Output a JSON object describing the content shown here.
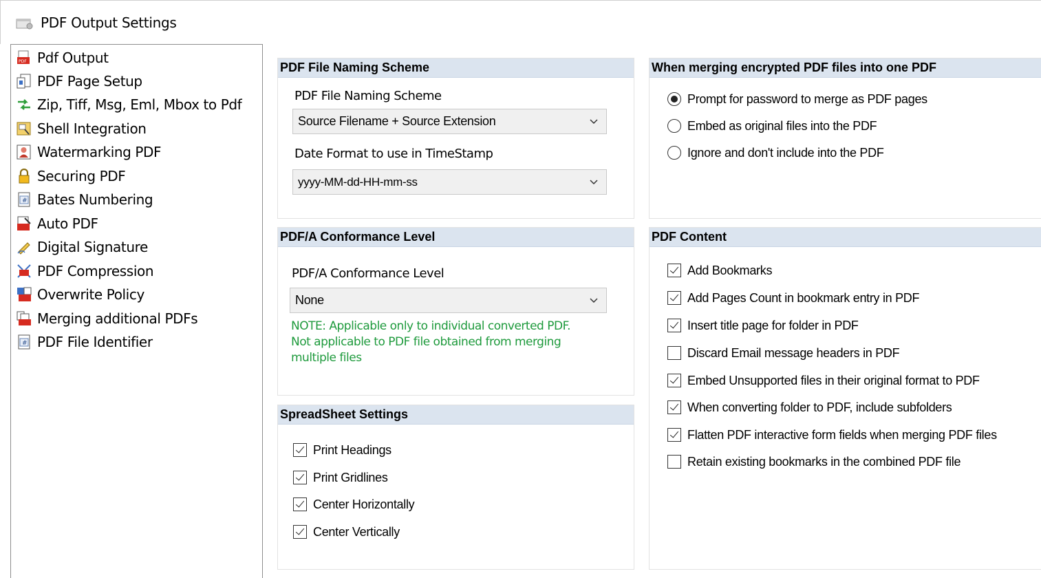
{
  "window": {
    "title": "PDF Output Settings",
    "icon": "settings-window-icon"
  },
  "sidebar": {
    "items": [
      {
        "label": "Pdf Output",
        "icon": "pdf-output-icon"
      },
      {
        "label": "PDF Page Setup",
        "icon": "page-setup-icon"
      },
      {
        "label": "Zip, Tiff, Msg, Eml, Mbox to Pdf",
        "icon": "convert-arrows-icon"
      },
      {
        "label": "Shell Integration",
        "icon": "shell-integration-icon"
      },
      {
        "label": "Watermarking PDF",
        "icon": "watermark-icon"
      },
      {
        "label": "Securing PDF",
        "icon": "lock-icon"
      },
      {
        "label": "Bates Numbering",
        "icon": "hash-icon"
      },
      {
        "label": "Auto PDF",
        "icon": "auto-pdf-icon"
      },
      {
        "label": "Digital Signature",
        "icon": "signature-pen-icon"
      },
      {
        "label": "PDF Compression",
        "icon": "compression-icon"
      },
      {
        "label": "Overwrite Policy",
        "icon": "overwrite-icon"
      },
      {
        "label": "Merging additional PDFs",
        "icon": "merge-pdf-icon"
      },
      {
        "label": "PDF File Identifier",
        "icon": "hash-icon"
      }
    ]
  },
  "naming": {
    "header": "PDF File Naming Scheme",
    "scheme_label": "PDF File Naming Scheme",
    "scheme_value": "Source Filename + Source Extension",
    "date_label": "Date Format to use in TimeStamp",
    "date_value": "yyyy-MM-dd-HH-mm-ss"
  },
  "encrypted": {
    "header": "When merging encrypted PDF files into one PDF",
    "options": [
      {
        "label": "Prompt for password to merge as PDF pages",
        "selected": true
      },
      {
        "label": "Embed as original files into the PDF",
        "selected": false
      },
      {
        "label": "Ignore and don't include into the PDF",
        "selected": false
      }
    ]
  },
  "pdfa": {
    "header": "PDF/A Conformance Level",
    "level_label": "PDF/A Conformance Level",
    "level_value": "None",
    "note_lines": [
      "NOTE: Applicable only to individual converted PDF.",
      "Not applicable to PDF file obtained from merging",
      "multiple files"
    ]
  },
  "spreadsheet": {
    "header": "SpreadSheet Settings",
    "options": [
      {
        "label": "Print Headings",
        "checked": true
      },
      {
        "label": "Print Gridlines",
        "checked": true
      },
      {
        "label": "Center Horizontally",
        "checked": true
      },
      {
        "label": "Center Vertically",
        "checked": true
      }
    ]
  },
  "content": {
    "header": "PDF Content",
    "options": [
      {
        "label": "Add Bookmarks",
        "checked": true
      },
      {
        "label": "Add Pages Count in bookmark entry in PDF",
        "checked": true
      },
      {
        "label": "Insert title page for folder in PDF",
        "checked": true
      },
      {
        "label": "Discard Email message headers in PDF",
        "checked": false
      },
      {
        "label": "Embed Unsupported files in their original format to PDF",
        "checked": true
      },
      {
        "label": "When converting folder to PDF, include subfolders",
        "checked": true
      },
      {
        "label": "Flatten PDF interactive form fields when merging PDF files",
        "checked": true
      },
      {
        "label": "Retain existing bookmarks in the combined PDF file",
        "checked": false
      }
    ]
  },
  "colors": {
    "header_bg": "#dbe4ef",
    "note_green": "#1e9a3c",
    "select_bg": "#f0f0f0"
  }
}
